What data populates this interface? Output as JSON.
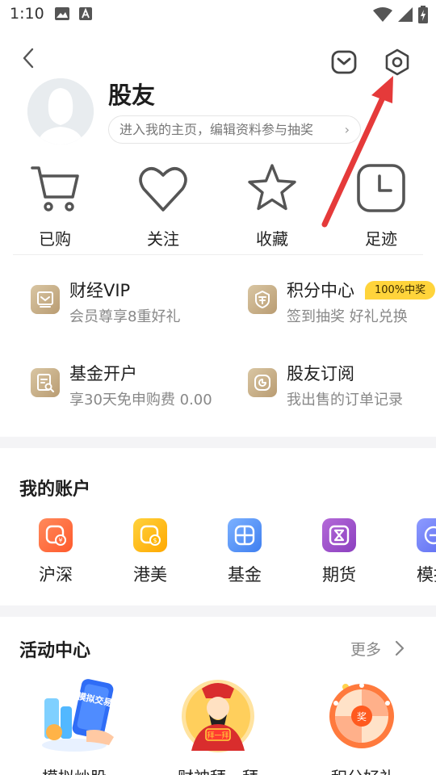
{
  "status_bar": {
    "time": "1:10"
  },
  "header": {
    "back_icon": "back-chevron-icon",
    "message_icon": "mail-icon",
    "settings_icon": "gear-icon"
  },
  "profile": {
    "username": "股友",
    "link_text": "进入我的主页，编辑资料参与抽奖"
  },
  "quick_links": [
    {
      "label": "已购",
      "icon": "cart-icon"
    },
    {
      "label": "关注",
      "icon": "heart-icon"
    },
    {
      "label": "收藏",
      "icon": "star-icon"
    },
    {
      "label": "足迹",
      "icon": "clock-icon"
    }
  ],
  "services": [
    {
      "title": "财经VIP",
      "subtitle": "会员尊享8重好礼",
      "icon": "vip-icon"
    },
    {
      "title": "积分中心",
      "subtitle": "签到抽奖 好礼兑换",
      "icon": "points-icon",
      "badge": "100%中奖"
    },
    {
      "title": "基金开户",
      "subtitle": "享30天免申购费 0.00",
      "icon": "fund-account-icon"
    },
    {
      "title": "股友订阅",
      "subtitle": "我出售的订单记录",
      "icon": "subscription-icon"
    }
  ],
  "accounts": {
    "title": "我的账户",
    "items": [
      {
        "label": "沪深",
        "icon": "hs-market-icon",
        "color": "#ff6b3d"
      },
      {
        "label": "港美",
        "icon": "hk-us-market-icon",
        "color": "#ffb400"
      },
      {
        "label": "基金",
        "icon": "fund-icon",
        "color": "#4d8ff5"
      },
      {
        "label": "期货",
        "icon": "futures-icon",
        "color": "#9b4ec9"
      },
      {
        "label": "模拟",
        "icon": "simulation-icon",
        "color": "#6f7ff5"
      }
    ]
  },
  "activities": {
    "title": "活动中心",
    "more": "更多",
    "items": [
      {
        "label": "模拟炒股",
        "image_text": "模拟交易",
        "icon": "phone-trading-illustration"
      },
      {
        "label": "财神拜一拜",
        "image_text": "拜一拜",
        "icon": "fortune-god-illustration"
      },
      {
        "label": "积分好礼",
        "image_text": "奖",
        "icon": "prize-wheel-illustration"
      }
    ]
  }
}
